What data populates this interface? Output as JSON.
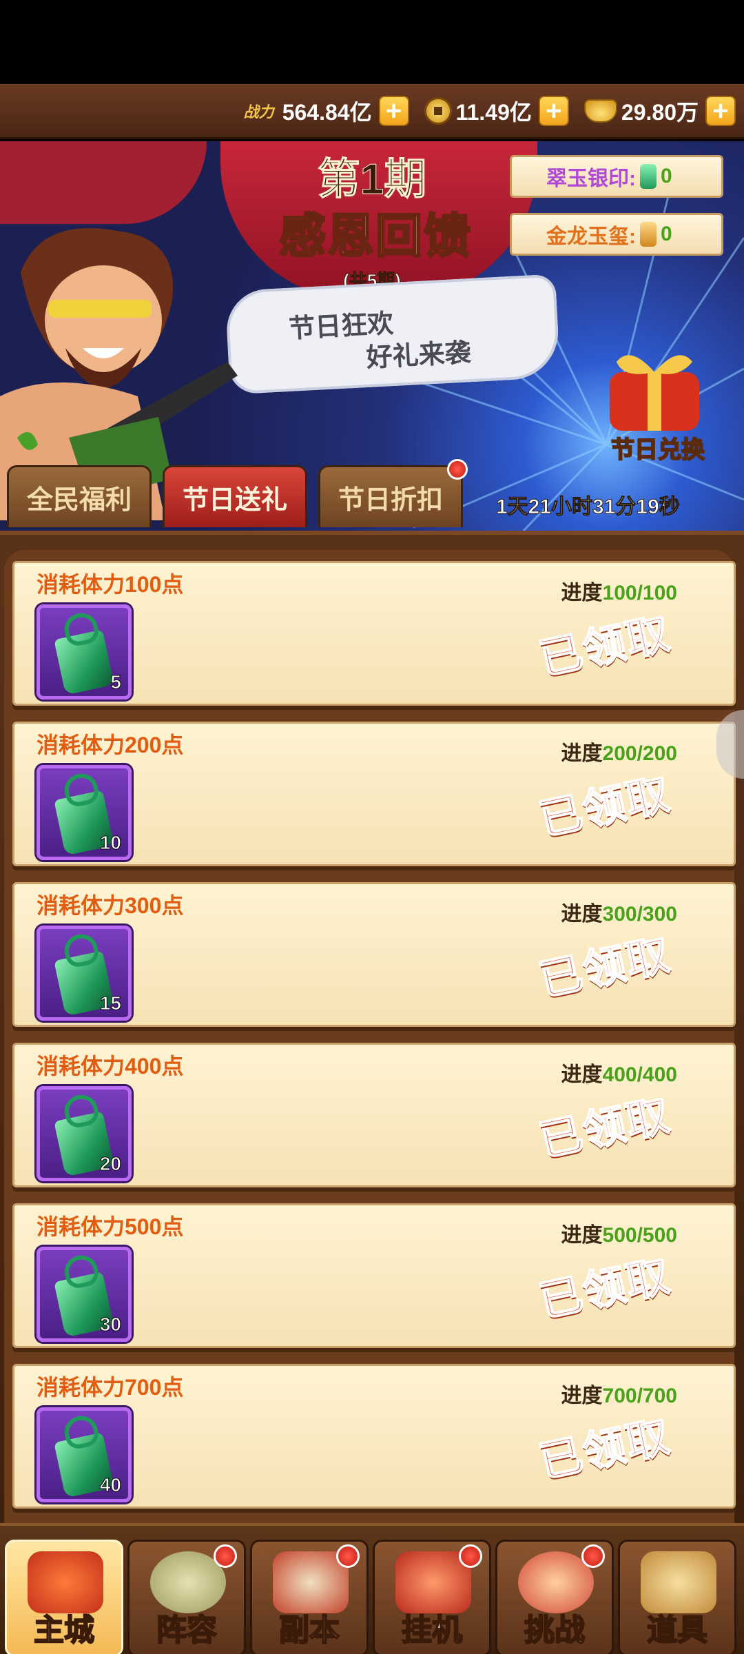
{
  "resources": [
    {
      "label": "战力",
      "value": "564.84亿",
      "icon": "power-text"
    },
    {
      "label": "",
      "value": "11.49亿",
      "icon": "coin-icon"
    },
    {
      "label": "",
      "value": "29.80万",
      "icon": "gold-ingot-icon"
    }
  ],
  "banner": {
    "period": "第1期",
    "title": "感恩回馈",
    "total_periods": "(共5期)",
    "slogan_line1": "节日狂欢",
    "slogan_line2": "好礼来袭",
    "seal1_label": "翠玉银印:",
    "seal1_count": "0",
    "seal2_label": "金龙玉玺:",
    "seal2_count": "0",
    "exchange_label": "节日兑换",
    "timer": "1天21小时31分19秒",
    "colors": {
      "seal1": "#b04ad6",
      "seal2": "#e2701a"
    }
  },
  "tabs": [
    {
      "label": "全民福利",
      "active": false
    },
    {
      "label": "节日送礼",
      "active": true
    },
    {
      "label": "节日折扣",
      "active": false,
      "badge": true
    }
  ],
  "tasks": [
    {
      "name": "消耗体力100点",
      "progress_label": "进度",
      "progress": "100/100",
      "reward_count": "5",
      "status": "已领取"
    },
    {
      "name": "消耗体力200点",
      "progress_label": "进度",
      "progress": "200/200",
      "reward_count": "10",
      "status": "已领取"
    },
    {
      "name": "消耗体力300点",
      "progress_label": "进度",
      "progress": "300/300",
      "reward_count": "15",
      "status": "已领取"
    },
    {
      "name": "消耗体力400点",
      "progress_label": "进度",
      "progress": "400/400",
      "reward_count": "20",
      "status": "已领取"
    },
    {
      "name": "消耗体力500点",
      "progress_label": "进度",
      "progress": "500/500",
      "reward_count": "30",
      "status": "已领取"
    },
    {
      "name": "消耗体力700点",
      "progress_label": "进度",
      "progress": "700/700",
      "reward_count": "40",
      "status": "已领取"
    }
  ],
  "nav": [
    {
      "label": "主城",
      "active": true,
      "badge": false
    },
    {
      "label": "阵容",
      "active": false,
      "badge": true
    },
    {
      "label": "副本",
      "active": false,
      "badge": true
    },
    {
      "label": "挂机",
      "active": false,
      "badge": true
    },
    {
      "label": "挑战",
      "active": false,
      "badge": true
    },
    {
      "label": "道具",
      "active": false,
      "badge": false
    }
  ]
}
